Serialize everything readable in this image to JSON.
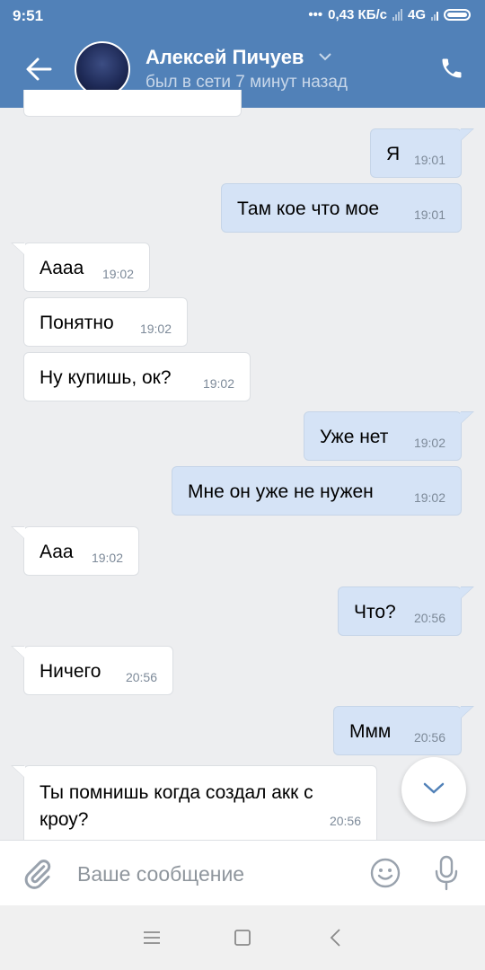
{
  "status_bar": {
    "time": "9:51",
    "dots": "•••",
    "speed": "0,43 КБ/с",
    "network": "4G"
  },
  "header": {
    "name": "Алексей Пичуев",
    "last_seen": "был в сети 7 минут назад"
  },
  "messages": [
    {
      "dir": "out",
      "text": "Я",
      "time": "19:01"
    },
    {
      "dir": "out",
      "text": "Там кое что мое",
      "time": "19:01"
    },
    {
      "dir": "in",
      "text": "Аааа",
      "time": "19:02"
    },
    {
      "dir": "in",
      "text": "Понятно",
      "time": "19:02"
    },
    {
      "dir": "in",
      "text": "Ну купишь, ок?",
      "time": "19:02"
    },
    {
      "dir": "out",
      "text": "Уже нет",
      "time": "19:02"
    },
    {
      "dir": "out",
      "text": "Мне он уже не нужен",
      "time": "19:02"
    },
    {
      "dir": "in",
      "text": "Ааа",
      "time": "19:02"
    },
    {
      "dir": "out",
      "text": "Что?",
      "time": "20:56"
    },
    {
      "dir": "in",
      "text": "Ничего",
      "time": "20:56"
    },
    {
      "dir": "out",
      "text": "Ммм",
      "time": "20:56"
    },
    {
      "dir": "in",
      "text": "Ты помнишь когда создал акк с кроу?",
      "time": "20:56"
    }
  ],
  "composer": {
    "placeholder": "Ваше сообщение"
  },
  "colors": {
    "header": "#5181b8",
    "incoming_bubble": "#ffffff",
    "outgoing_bubble": "#d5e3f6",
    "background": "#edeef0"
  }
}
